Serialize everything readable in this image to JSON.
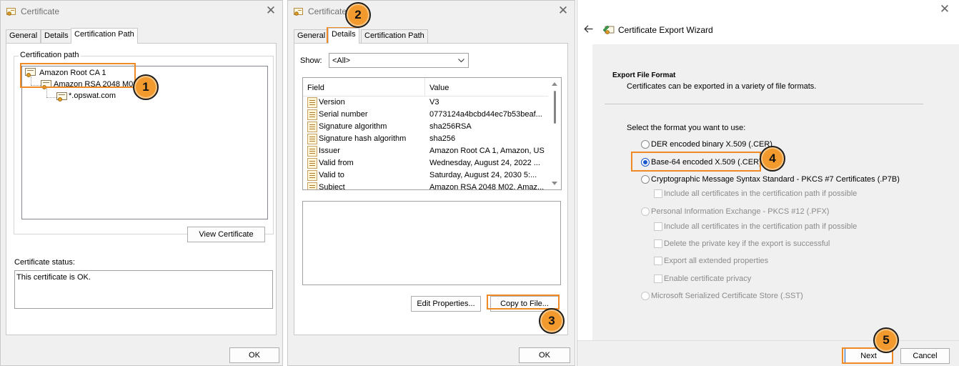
{
  "window1": {
    "title": "Certificate",
    "tabs": [
      "General",
      "Details",
      "Certification Path"
    ],
    "path_group_label": "Certification path",
    "tree": [
      "Amazon Root CA 1",
      "Amazon RSA 2048 M02",
      "*.opswat.com"
    ],
    "view_certificate_label": "View Certificate",
    "status_label": "Certificate status:",
    "status_text": "This certificate is OK.",
    "ok_label": "OK"
  },
  "window2": {
    "title": "Certificate",
    "tabs": [
      "General",
      "Details",
      "Certification Path"
    ],
    "show_label": "Show:",
    "show_value": "<All>",
    "columns": [
      "Field",
      "Value"
    ],
    "rows": [
      {
        "field": "Version",
        "value": "V3"
      },
      {
        "field": "Serial number",
        "value": "0773124a4bcbd44ec7b53beaf..."
      },
      {
        "field": "Signature algorithm",
        "value": "sha256RSA"
      },
      {
        "field": "Signature hash algorithm",
        "value": "sha256"
      },
      {
        "field": "Issuer",
        "value": "Amazon Root CA 1, Amazon, US"
      },
      {
        "field": "Valid from",
        "value": "Wednesday, August 24, 2022 ..."
      },
      {
        "field": "Valid to",
        "value": "Saturday, August 24, 2030 5:..."
      },
      {
        "field": "Subject",
        "value": "Amazon RSA 2048 M02, Amaz..."
      }
    ],
    "edit_properties_label": "Edit Properties...",
    "copy_to_file_label": "Copy to File...",
    "ok_label": "OK"
  },
  "wizard": {
    "title": "Certificate Export Wizard",
    "section_title": "Export File Format",
    "section_subtitle": "Certificates can be exported in a variety of file formats.",
    "prompt": "Select the format you want to use:",
    "options": {
      "der": "DER encoded binary X.509 (.CER)",
      "base64": "Base-64 encoded X.509 (.CER)",
      "pkcs7": "Cryptographic Message Syntax Standard - PKCS #7 Certificates (.P7B)",
      "pkcs7_include": "Include all certificates in the certification path if possible",
      "pfx": "Personal Information Exchange - PKCS #12 (.PFX)",
      "pfx_include": "Include all certificates in the certification path if possible",
      "pfx_delete_key": "Delete the private key if the export is successful",
      "pfx_export_props": "Export all extended properties",
      "pfx_privacy": "Enable certificate privacy",
      "sst": "Microsoft Serialized Certificate Store (.SST)"
    },
    "selected_option": "base64",
    "next_label": "Next",
    "cancel_label": "Cancel"
  },
  "steps": [
    "1",
    "2",
    "3",
    "4",
    "5"
  ],
  "colors": {
    "highlight": "#f08a24",
    "badge": "#f29a2e",
    "radio_selected": "#1a58c9"
  },
  "icons": [
    "certificate-icon",
    "close-icon",
    "back-arrow-icon",
    "wizard-icon",
    "dropdown-chevron-icon"
  ]
}
